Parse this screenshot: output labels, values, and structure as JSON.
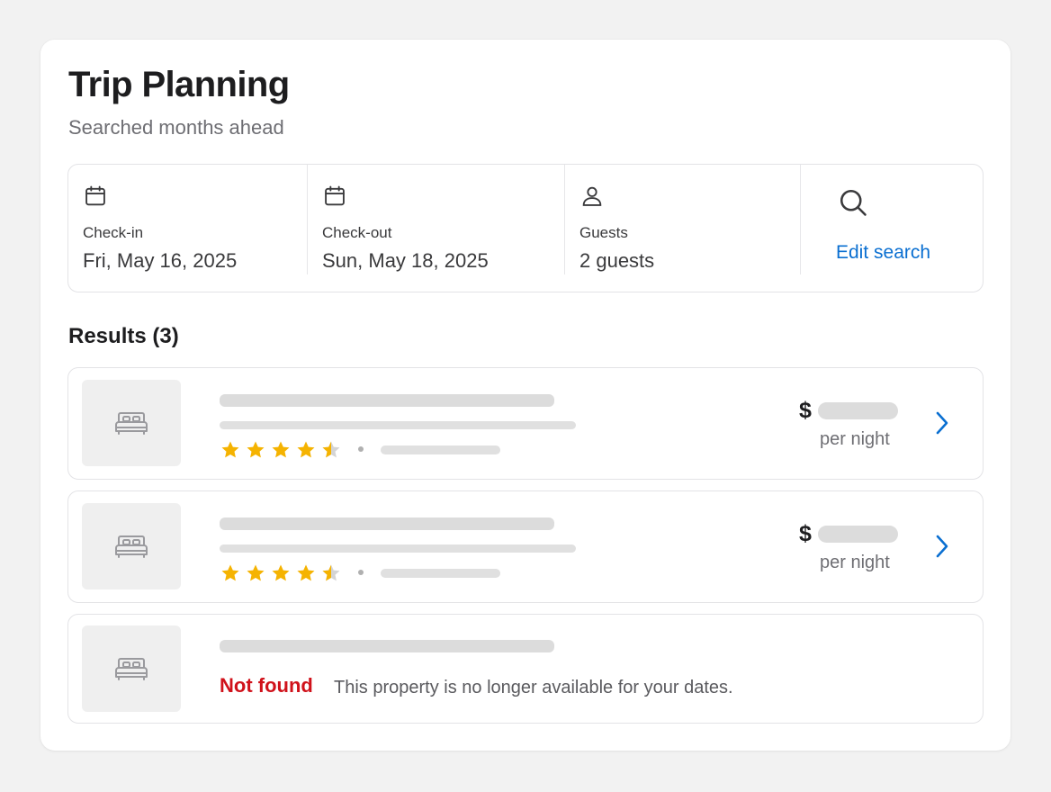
{
  "header": {
    "title": "Trip Planning",
    "subtitle": "Searched months ahead"
  },
  "search": {
    "check_in": {
      "label": "Check-in",
      "value": "Fri, May 16, 2025",
      "icon": "calendar-icon"
    },
    "check_out": {
      "label": "Check-out",
      "value": "Sun, May 18, 2025",
      "icon": "calendar-icon"
    },
    "guests": {
      "label": "Guests",
      "value": "2 guests",
      "icon": "person-icon"
    },
    "edit": {
      "label": "Edit search",
      "icon": "search-icon"
    }
  },
  "results": {
    "heading": "Results (3)",
    "items": [
      {
        "status": "loading",
        "currency": "$",
        "price_unit": "per night",
        "rating": 4.5,
        "image_icon": "bed-icon"
      },
      {
        "status": "loading",
        "currency": "$",
        "price_unit": "per night",
        "rating": 4.5,
        "image_icon": "bed-icon"
      },
      {
        "status": "not_found",
        "status_label": "Not found",
        "message": "This property is no longer available for your dates.",
        "image_icon": "bed-icon"
      }
    ]
  },
  "colors": {
    "accent": "#0a6fd1",
    "error": "#d0121b",
    "star": "#f5b301",
    "star_empty": "#d4d4d4",
    "skeleton": "#dcdcdc",
    "background": "#f2f2f2"
  }
}
